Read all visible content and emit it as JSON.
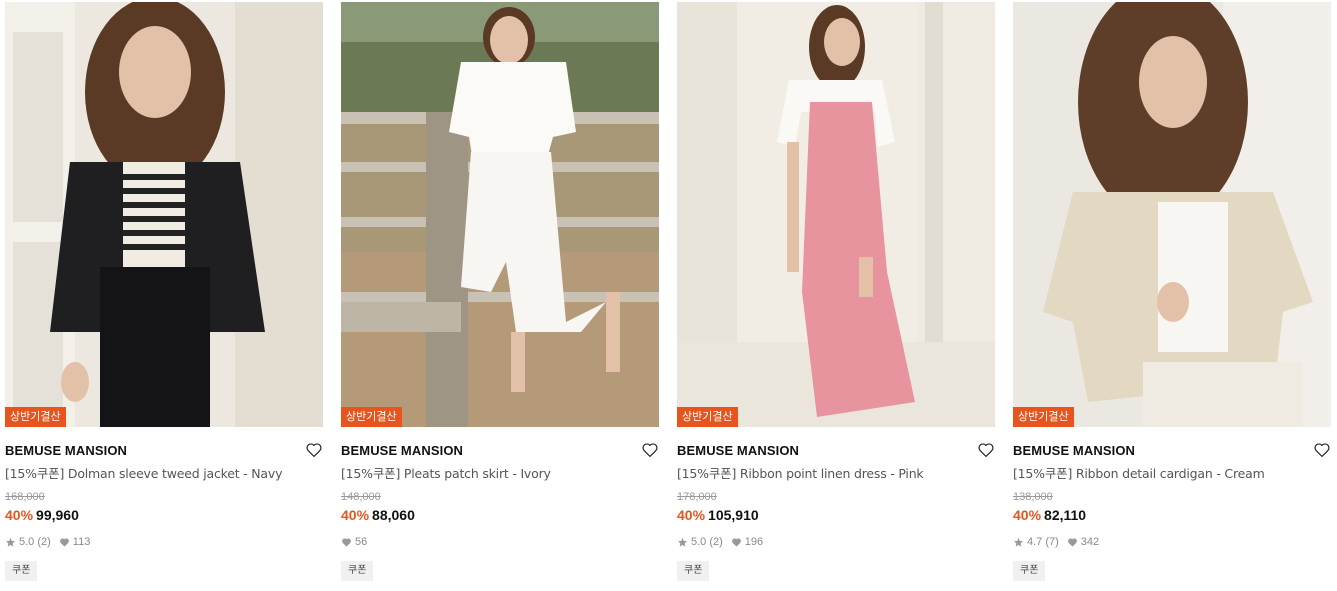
{
  "products": [
    {
      "badge": "상반기결산",
      "brand": "BEMUSE MANSION",
      "title": "[15%쿠폰] Dolman sleeve tweed jacket - Navy",
      "original_price": "168,000",
      "discount": "40%",
      "price": "99,960",
      "rating": "5.0 (2)",
      "likes": "113",
      "coupon": "쿠폰"
    },
    {
      "badge": "상반기결산",
      "brand": "BEMUSE MANSION",
      "title": "[15%쿠폰] Pleats patch skirt - Ivory",
      "original_price": "148,000",
      "discount": "40%",
      "price": "88,060",
      "rating": "",
      "likes": "56",
      "coupon": "쿠폰"
    },
    {
      "badge": "상반기결산",
      "brand": "BEMUSE MANSION",
      "title": "[15%쿠폰] Ribbon point linen dress - Pink",
      "original_price": "178,000",
      "discount": "40%",
      "price": "105,910",
      "rating": "5.0 (2)",
      "likes": "196",
      "coupon": "쿠폰"
    },
    {
      "badge": "상반기결산",
      "brand": "BEMUSE MANSION",
      "title": "[15%쿠폰] Ribbon detail cardigan - Cream",
      "original_price": "138,000",
      "discount": "40%",
      "price": "82,110",
      "rating": "4.7 (7)",
      "likes": "342",
      "coupon": "쿠폰"
    }
  ],
  "photo_text": "BEMUSE MANSION",
  "colors": {
    "accent": "#e8541e",
    "badge_bg": "#e8541e",
    "coupon_bg": "#f0f0f0"
  }
}
